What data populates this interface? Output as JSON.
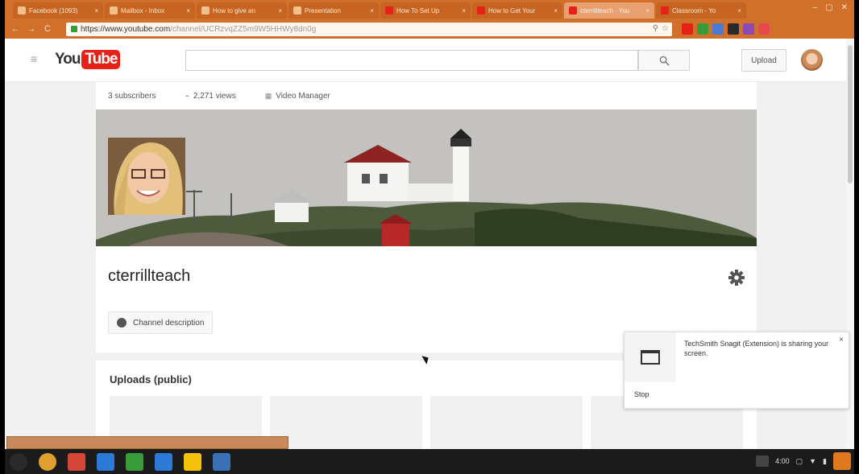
{
  "browser": {
    "tabs": [
      {
        "title": "Facebook (1093)",
        "color": "#f2c08a"
      },
      {
        "title": "Mailbox - Inbox",
        "color": "#f2c08a"
      },
      {
        "title": "How to give an",
        "color": "#f2c08a"
      },
      {
        "title": "Presentation",
        "color": "#f2c08a"
      },
      {
        "title": "How To Set Up",
        "color": "#e62117"
      },
      {
        "title": "How to Get Your",
        "color": "#e62117"
      },
      {
        "title": "cterrillteach - You",
        "color": "#e62117",
        "active": true
      },
      {
        "title": "Classroom - Yo",
        "color": "#e62117"
      }
    ],
    "url_host": "https://www.youtube.com",
    "url_path": "/channel/UCRzvqZZ5m9W5HHWy8dn0g",
    "nav": {
      "back": "←",
      "forward": "→",
      "reload": "C"
    },
    "window_controls": [
      "–",
      "▢",
      "✕"
    ],
    "extension_colors": [
      "#e62117",
      "#3a9b3a",
      "#4a7bd0",
      "#2a2a2a",
      "#8a4ab0",
      "#e64a4a"
    ]
  },
  "youtube": {
    "logo_you": "You",
    "logo_tube": "Tube",
    "search_placeholder": "",
    "upload_label": "Upload",
    "channel": {
      "subscribers": "3 subscribers",
      "views": "2,271 views",
      "video_manager": "Video Manager",
      "name": "cterrillteach",
      "description_button": "Channel description"
    },
    "uploads_title": "Uploads (public)"
  },
  "notification": {
    "text": "TechSmith Snagit (Extension) is sharing your screen.",
    "stop_label": "Stop",
    "close": "×"
  },
  "status_bar": "",
  "taskbar": {
    "apps": [
      {
        "name": "launcher",
        "color": "#2a2a2a"
      },
      {
        "name": "chrome",
        "color": "#e0a030"
      },
      {
        "name": "gmail",
        "color": "#d44638"
      },
      {
        "name": "docs",
        "color": "#2c7ad6"
      },
      {
        "name": "sheets",
        "color": "#3a9b3a"
      },
      {
        "name": "drive",
        "color": "#2c7ad6"
      },
      {
        "name": "keep",
        "color": "#f4c20d"
      },
      {
        "name": "calendar",
        "color": "#3b6fb6"
      }
    ],
    "time": "4:00"
  }
}
